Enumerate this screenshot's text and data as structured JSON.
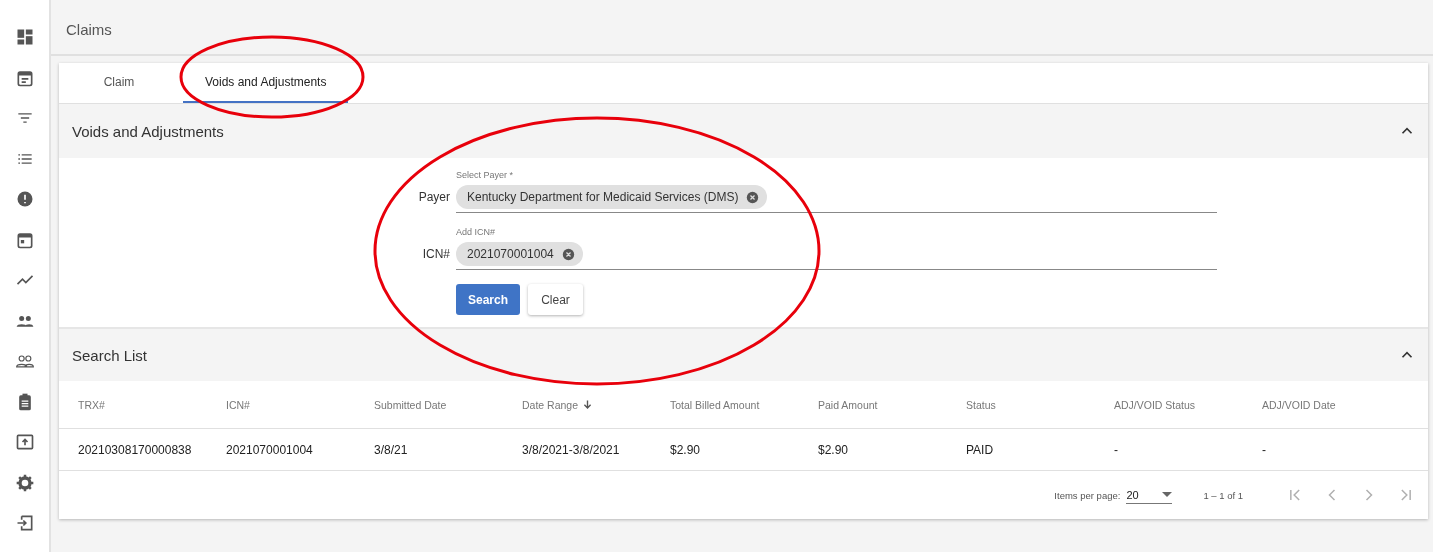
{
  "sidebar": {
    "items": [
      {
        "kind": "dashboard"
      },
      {
        "kind": "calendar-note"
      },
      {
        "kind": "filter"
      },
      {
        "kind": "list"
      },
      {
        "kind": "alert"
      },
      {
        "kind": "calendar"
      },
      {
        "kind": "chart"
      },
      {
        "kind": "people"
      },
      {
        "kind": "people-outline"
      },
      {
        "kind": "clipboard"
      },
      {
        "kind": "upload"
      },
      {
        "kind": "settings"
      },
      {
        "kind": "logout"
      }
    ]
  },
  "page_title": "Claims",
  "tabs": [
    {
      "label": "Claim",
      "selected": false
    },
    {
      "label": "Voids and Adjustments",
      "selected": true
    }
  ],
  "form_panel": {
    "title": "Voids and Adjustments",
    "expanded": true,
    "fields": [
      {
        "label": "Payer",
        "floating_label": "Select Payer *",
        "chips": [
          "Kentucky Department for Medicaid Services (DMS)"
        ]
      },
      {
        "label": "ICN#",
        "floating_label": "Add ICN#",
        "chips": [
          "2021070001004"
        ]
      }
    ],
    "buttons": [
      {
        "label": "Search",
        "kind": "primary"
      },
      {
        "label": "Clear",
        "kind": "secondary"
      }
    ]
  },
  "results_panel": {
    "title": "Search List",
    "expanded": true,
    "columns": [
      {
        "label": "TRX#",
        "sorted": false
      },
      {
        "label": "ICN#",
        "sorted": false
      },
      {
        "label": "Submitted Date",
        "sorted": false
      },
      {
        "label": "Date Range",
        "sorted": true
      },
      {
        "label": "Total Billed Amount",
        "sorted": false
      },
      {
        "label": "Paid Amount",
        "sorted": false
      },
      {
        "label": "Status",
        "sorted": false
      },
      {
        "label": "ADJ/VOID Status",
        "sorted": false
      },
      {
        "label": "ADJ/VOID Date",
        "sorted": false
      }
    ],
    "rows": [
      [
        "20210308170000838",
        "2021070001004",
        "3/8/21",
        "3/8/2021-3/8/2021",
        "$2.90",
        "$2.90",
        "PAID",
        "-",
        "-"
      ]
    ],
    "paginator": {
      "items_per_page_label": "Items per page:",
      "page_size": "20",
      "range": "1 – 1 of 1",
      "nav": [
        {
          "kind": "first",
          "disabled": true
        },
        {
          "kind": "prev",
          "disabled": true
        },
        {
          "kind": "next",
          "disabled": true
        },
        {
          "kind": "last",
          "disabled": true
        }
      ]
    }
  }
}
